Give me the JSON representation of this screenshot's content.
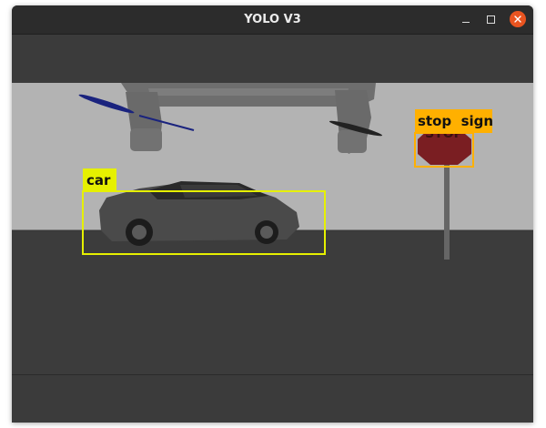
{
  "window": {
    "title": "YOLO V3"
  },
  "controls": {
    "minimize_icon": "minimize-icon",
    "maximize_icon": "maximize-icon",
    "close_icon": "close-icon",
    "close_color": "#e95420"
  },
  "detections": [
    {
      "label": "car",
      "color": "#e6f000"
    },
    {
      "label": "stop  sign",
      "color": "#ffb000"
    }
  ]
}
